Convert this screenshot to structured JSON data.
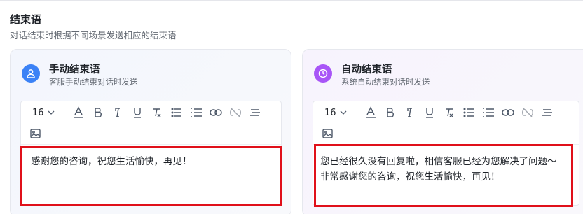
{
  "section": {
    "title": "结束语",
    "description": "对话结束时根据不同场景发送相应的结束语"
  },
  "cards": {
    "manual": {
      "title": "手动结束语",
      "subtitle": "客服手动结束对话时发送",
      "icon": "user-icon",
      "accent": "#3b82f6",
      "font_size": "16",
      "content": [
        "感谢您的咨询，祝您生活愉快，再见！"
      ]
    },
    "auto": {
      "title": "自动结束语",
      "subtitle": "系统自动结束对话时发送",
      "icon": "clock-icon",
      "accent": "#a855f7",
      "font_size": "16",
      "content": [
        "您已经很久没有回复啦，相信客服已经为您解决了问题～",
        "非常感谢您的咨询，祝您生活愉快，再见！"
      ]
    }
  },
  "highlight_color": "#e0101a"
}
